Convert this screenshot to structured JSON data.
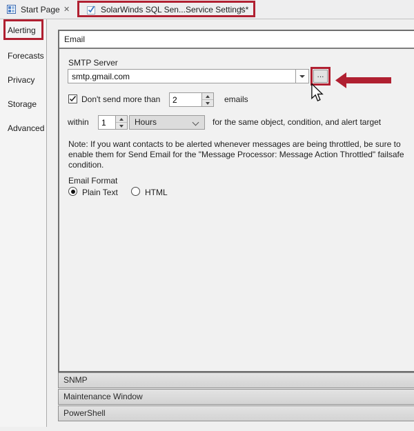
{
  "colors": {
    "annotation_red": "#b02031",
    "icon_blue": "#4f81c7",
    "check_blue": "#3a76c4"
  },
  "tab_bar": {
    "tabs": [
      {
        "label": "Start Page",
        "icon": "grid-icon",
        "close_glyph": "✕"
      },
      {
        "label": "SolarWinds SQL Sen...Service Settings*",
        "icon": "checkmark-icon",
        "close_glyph": "✕",
        "annotated": true
      }
    ]
  },
  "sidebar": {
    "items": [
      {
        "label": "Alerting",
        "annotated": true
      },
      {
        "label": "Forecasts"
      },
      {
        "label": "Privacy"
      },
      {
        "label": "Storage"
      },
      {
        "label": "Advanced"
      }
    ]
  },
  "panel": {
    "title": "Email",
    "smtp": {
      "label": "SMTP Server",
      "value": "smtp.gmail.com",
      "browse_label": "..."
    },
    "throttle": {
      "checkbox_label": "Don't send more than",
      "checkbox_checked": true,
      "count_value": "2",
      "count_unit": "emails",
      "within_label": "within",
      "within_value": "1",
      "period_value": "Hours",
      "suffix": "for the same object, condition, and alert target"
    },
    "note_lines": [
      "Note:  If you want contacts to be alerted whenever messages are being throttled, be sure to",
      "enable them for Send Email for the \"Message Processor: Message Action Throttled\" failsafe",
      "condition."
    ],
    "email_format": {
      "label": "Email Format",
      "options": [
        {
          "label": "Plain Text",
          "selected": true
        },
        {
          "label": "HTML",
          "selected": false
        }
      ]
    }
  },
  "sections": [
    {
      "label": "SNMP"
    },
    {
      "label": "Maintenance Window"
    },
    {
      "label": "PowerShell"
    }
  ]
}
